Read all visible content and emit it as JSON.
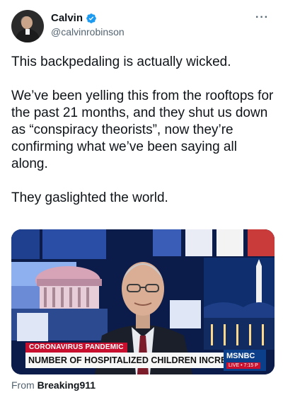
{
  "author": {
    "display_name": "Calvin",
    "handle": "@calvinrobinson",
    "verified": true,
    "avatar_icon": "profile-photo"
  },
  "more_menu": {
    "label": "···"
  },
  "tweet": {
    "paragraphs": [
      "This backpedaling is actually wicked.",
      "We’ve been yelling this from the rooftops for the past 21 months, and they shut us down as “conspiracy theorists”, now they’re confirming what we’ve been saying all along.",
      "They gaslighted the world."
    ]
  },
  "media": {
    "lower_third_tag": "CORONAVIRUS PANDEMIC",
    "lower_third_headline": "NUMBER OF HOSPITALIZED CHILDREN INCREASES",
    "network": "MSNBC",
    "live_label": "LIVE • 7:15 P"
  },
  "source": {
    "prefix": "From",
    "name": "Breaking911"
  },
  "colors": {
    "text_primary": "#0f1419",
    "text_secondary": "#536471",
    "verified_blue": "#1d9bf0",
    "news_red": "#c8102e",
    "news_blue": "#0b3f8a"
  }
}
